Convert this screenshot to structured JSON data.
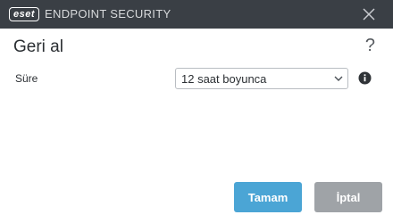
{
  "titlebar": {
    "logo_text": "eset",
    "product_name": "ENDPOINT SECURITY",
    "close_icon": "close-icon"
  },
  "dialog": {
    "title": "Geri al",
    "help_icon": "question-mark-icon",
    "help_glyph": "?",
    "duration_label": "Süre",
    "duration_value": "12 saat boyunca",
    "info_icon": "info-icon"
  },
  "buttons": {
    "ok_label": "Tamam",
    "cancel_label": "İptal"
  },
  "colors": {
    "titlebar_bg": "#3a3f45",
    "ok_button": "#4ba5d5",
    "cancel_button": "#9fa3a7"
  }
}
